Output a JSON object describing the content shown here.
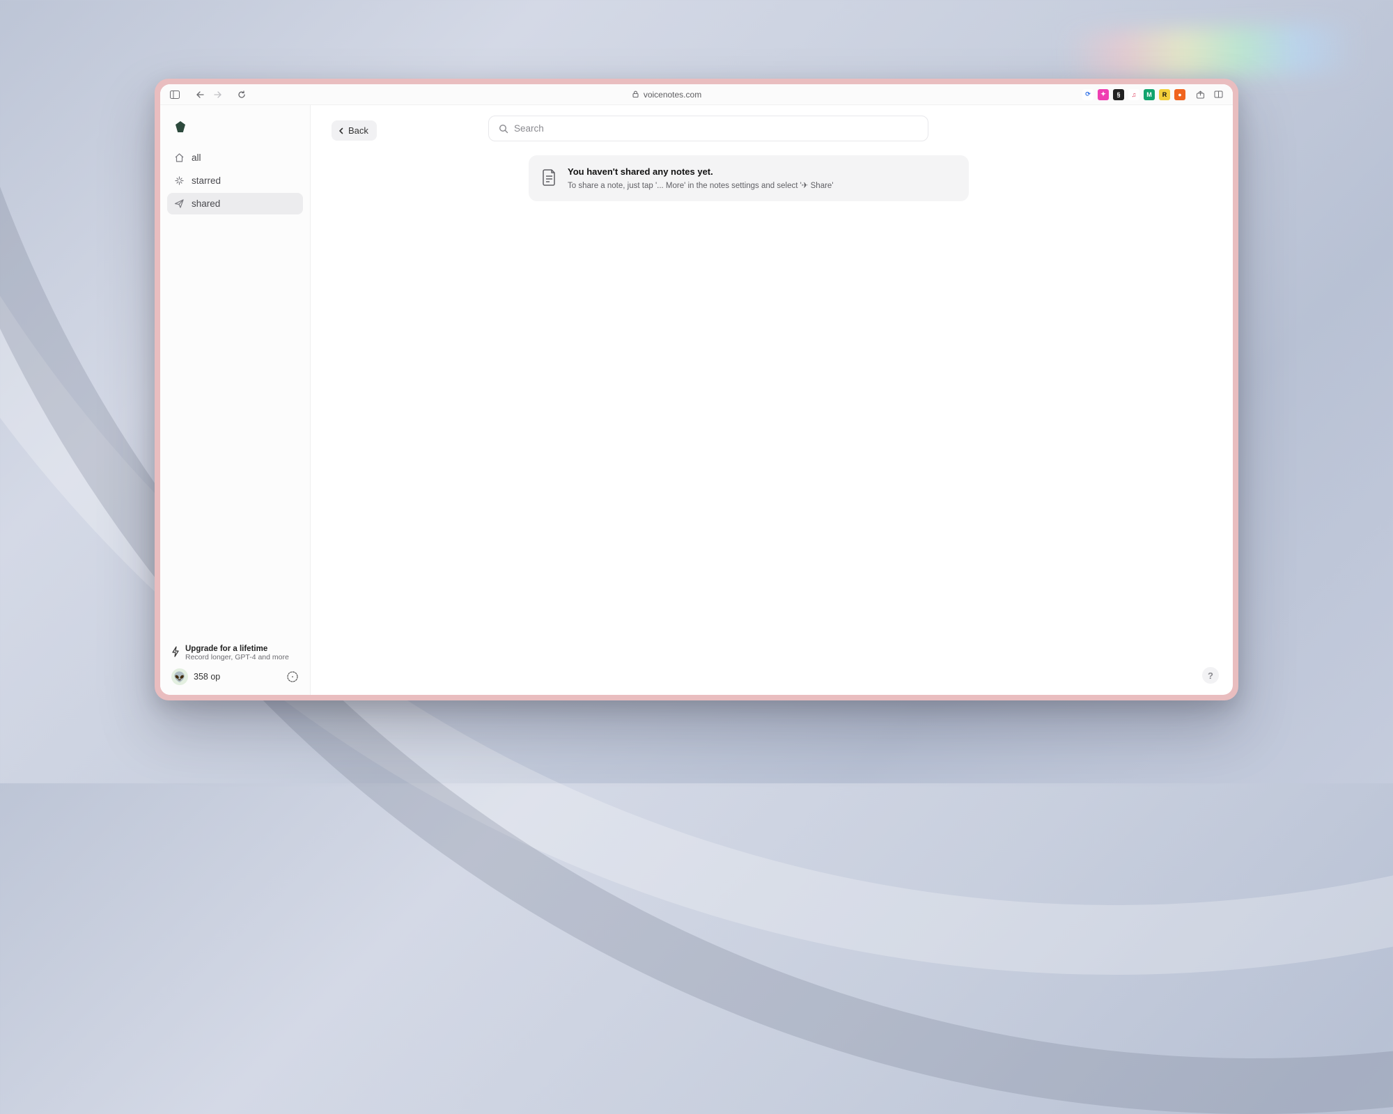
{
  "browser": {
    "url_display": "voicenotes.com",
    "extensions": [
      {
        "name": "translate-icon",
        "bg": "#ffffff",
        "fg": "#3b78e7",
        "glyph": "⟳"
      },
      {
        "name": "ext-pink-icon",
        "bg": "#ef3fb1",
        "fg": "#ffffff",
        "glyph": "✦"
      },
      {
        "name": "ext-dark-icon",
        "bg": "#222222",
        "fg": "#ffffff",
        "glyph": "§"
      },
      {
        "name": "ext-headphone-icon",
        "bg": "#ffffff",
        "fg": "#d35",
        "glyph": "♫"
      },
      {
        "name": "ext-m-icon",
        "bg": "#12a36d",
        "fg": "#ffffff",
        "glyph": "M"
      },
      {
        "name": "ext-r-icon",
        "bg": "#f3cf3a",
        "fg": "#111111",
        "glyph": "R"
      },
      {
        "name": "ext-orange-icon",
        "bg": "#f0641e",
        "fg": "#ffffff",
        "glyph": "●"
      }
    ]
  },
  "sidebar": {
    "items": [
      {
        "label": "all",
        "icon": "home-icon",
        "active": false
      },
      {
        "label": "starred",
        "icon": "sparkle-icon",
        "active": false
      },
      {
        "label": "shared",
        "icon": "paper-plane-icon",
        "active": true
      }
    ],
    "upgrade": {
      "title": "Upgrade for a lifetime",
      "subtitle": "Record longer, GPT-4 and more"
    },
    "user": {
      "name": "358 op",
      "avatar_emoji": "👽"
    }
  },
  "main": {
    "back_label": "Back",
    "search_placeholder": "Search",
    "notice": {
      "title": "You haven't shared any notes yet.",
      "body": "To share a note, just tap '... More' in the notes settings and select '✈ Share'"
    }
  },
  "help_fab": "?"
}
